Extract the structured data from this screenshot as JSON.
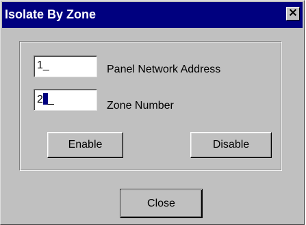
{
  "window": {
    "title": "Isolate By Zone",
    "close_glyph": "✕"
  },
  "fields": {
    "panel_address": {
      "value": "1_",
      "label": "Panel Network Address"
    },
    "zone_number": {
      "value": "2",
      "suffix": "_",
      "label": "Zone Number"
    }
  },
  "buttons": {
    "enable": "Enable",
    "disable": "Disable",
    "close": "Close"
  },
  "icons": {
    "close": "close-icon",
    "cursor": "text-cursor-icon"
  }
}
